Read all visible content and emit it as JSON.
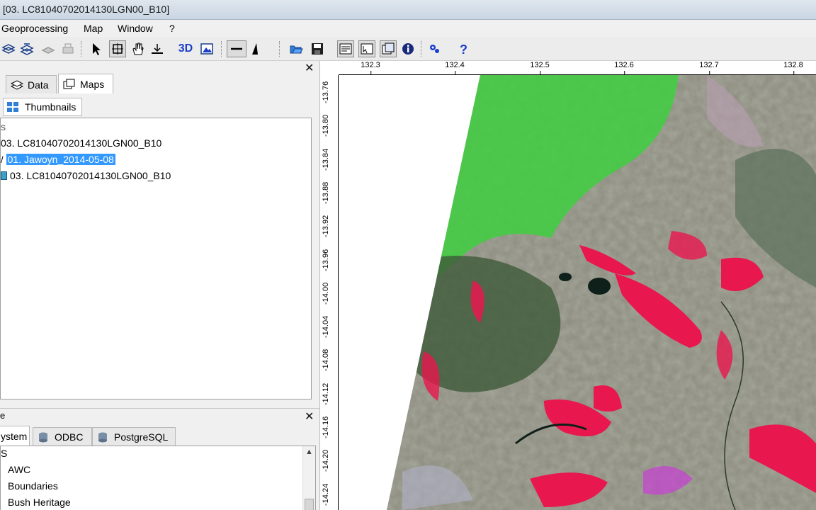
{
  "window": {
    "title": "[03. LC81040702014130LGN00_B10]"
  },
  "menu": [
    "Geoprocessing",
    "Map",
    "Window",
    "?"
  ],
  "toolbar": {
    "icons": [
      "layers-add-icon",
      "layers-stack-icon",
      "layers-remove-icon",
      "print-icon",
      "select-arrow-icon",
      "zoom-box-icon",
      "pan-hand-icon",
      "zoom-extent-icon",
      "3d-view-icon",
      "image-view-icon",
      "measure-distance-icon",
      "north-arrow-icon",
      "open-folder-icon",
      "save-disk-icon",
      "layout-icon",
      "layout-2-icon",
      "layout-3-icon",
      "info-icon",
      "settings-icon",
      "help-icon"
    ],
    "three_d_label": "3D"
  },
  "manager": {
    "tabs": [
      "Data",
      "Maps"
    ],
    "subtab": "Thumbnails",
    "tree": {
      "root": "s",
      "map": "03. LC81040702014130LGN00_B10",
      "layers": [
        "01. Jawoyn_2014-05-08",
        "03. LC81040702014130LGN00_B10"
      ]
    }
  },
  "datasources": {
    "header": "e",
    "tabs": [
      "ystem",
      "ODBC",
      "PostgreSQL"
    ],
    "tree": {
      "root": "S",
      "items": [
        "AWC",
        "Boundaries",
        "Bush Heritage"
      ]
    }
  },
  "map": {
    "x_ticks": [
      "132.3",
      "132.4",
      "132.5",
      "132.6",
      "132.7",
      "132.8"
    ],
    "y_ticks": [
      "-13.76",
      "-13.80",
      "-13.84",
      "-13.88",
      "-13.92",
      "-13.96",
      "-14.00",
      "-14.04",
      "-14.08",
      "-14.12",
      "-14.16",
      "-14.20",
      "-14.24"
    ],
    "colors": {
      "vegetation": "#3fcf3f",
      "burnt": "#e8174e",
      "water": "#0f1f1a",
      "bare": "#9a8f86"
    }
  }
}
